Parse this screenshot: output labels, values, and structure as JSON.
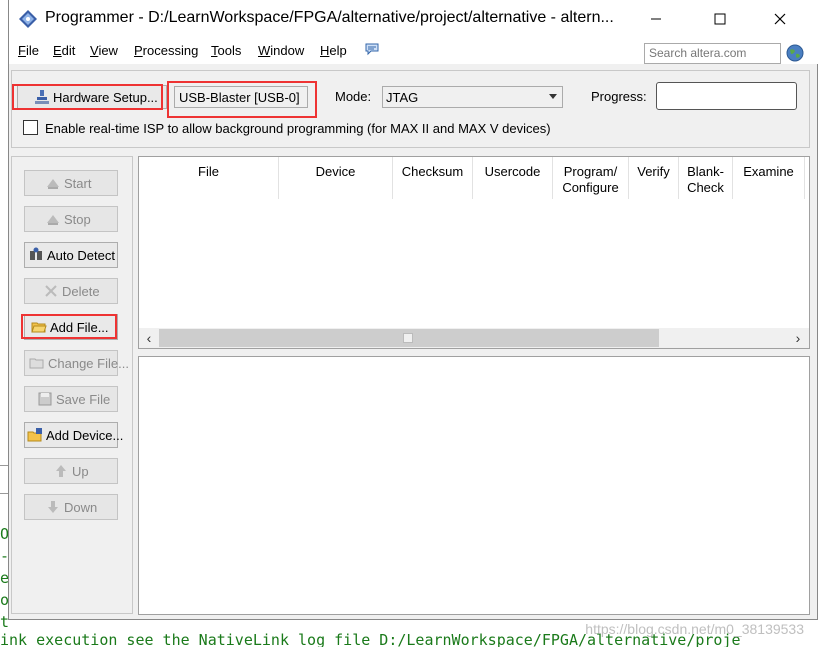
{
  "window": {
    "title": "Programmer - D:/LearnWorkspace/FPGA/alternative/project/alternative - altern..."
  },
  "menu": {
    "items": [
      {
        "label": "File",
        "mnemonic": "F",
        "rest": "ile"
      },
      {
        "label": "Edit",
        "mnemonic": "E",
        "rest": "dit"
      },
      {
        "label": "View",
        "mnemonic": "V",
        "rest": "iew"
      },
      {
        "label": "Processing",
        "mnemonic": "P",
        "rest": "rocessing"
      },
      {
        "label": "Tools",
        "mnemonic": "T",
        "rest": "ools"
      },
      {
        "label": "Window",
        "mnemonic": "W",
        "rest": "indow"
      },
      {
        "label": "Help",
        "mnemonic": "H",
        "rest": "elp"
      }
    ],
    "search_placeholder": "Search altera.com"
  },
  "hardware": {
    "setup_button": "Hardware Setup...",
    "device": "USB-Blaster [USB-0]",
    "mode_label": "Mode:",
    "mode_value": "JTAG",
    "progress_label": "Progress:",
    "isp_label": "Enable real-time ISP to allow background programming (for MAX II and MAX V devices)",
    "isp_checked": false
  },
  "buttons": {
    "start": "Start",
    "stop": "Stop",
    "auto_detect": "Auto Detect",
    "delete": "Delete",
    "add_file": "Add File...",
    "change_file": "Change File...",
    "save_file": "Save File",
    "add_device": "Add Device...",
    "up": "Up",
    "down": "Down"
  },
  "table": {
    "columns": {
      "file": "File",
      "device": "Device",
      "checksum": "Checksum",
      "usercode": "Usercode",
      "program_1": "Program/",
      "program_2": "Configure",
      "verify": "Verify",
      "blank_1": "Blank-",
      "blank_2": "Check",
      "examine": "Examine"
    }
  },
  "background": {
    "console_line": "ink execution see the NativeLink log file D:/LearnWorkspace/FPGA/alternative/proje",
    "watermark": "https://blog.csdn.net/m0_38139533"
  },
  "colors": {
    "highlight": "#e33333",
    "console_text": "#1a7a1a"
  }
}
